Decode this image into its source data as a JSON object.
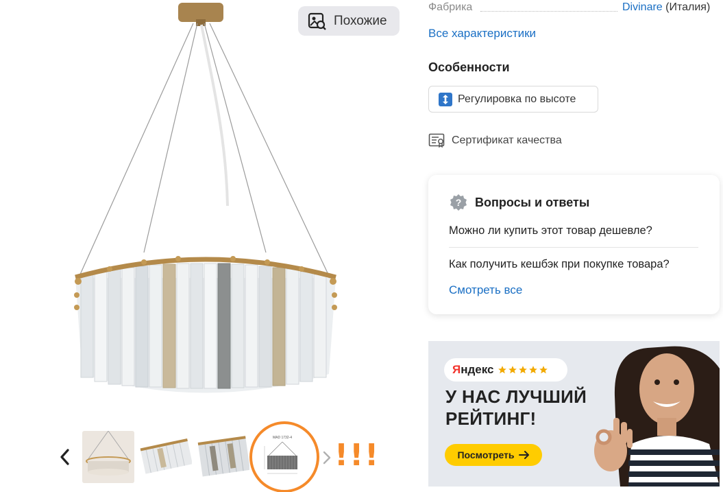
{
  "gallery": {
    "similar_label": "Похожие",
    "annotation_marks": "!!!",
    "thumbnail_labels": {
      "drawing": "MAD 1732-4"
    }
  },
  "specs": {
    "label": "Фабрика",
    "brand": "Divinare",
    "country": "(Италия)"
  },
  "all_specs_link": "Все характеристики",
  "features": {
    "title": "Особенности",
    "chip_label": "Регулировка по высоте"
  },
  "certificate_label": "Сертификат качества",
  "qa": {
    "title": "Вопросы и ответы",
    "questions": [
      "Можно ли купить этот товар дешевле?",
      "Как получить кешбэк при покупке товара?"
    ],
    "see_all": "Смотреть все"
  },
  "banner": {
    "brand": "Яндекс",
    "headline": "У НАС ЛУЧШИЙ РЕЙТИНГ!",
    "button_label": "Посмотреть",
    "stars_shown": 5
  },
  "colors": {
    "link": "#1a6fc4",
    "accent_orange": "#f58a2a",
    "yandex_yellow": "#ffcc00",
    "yandex_red": "#f2322b"
  }
}
